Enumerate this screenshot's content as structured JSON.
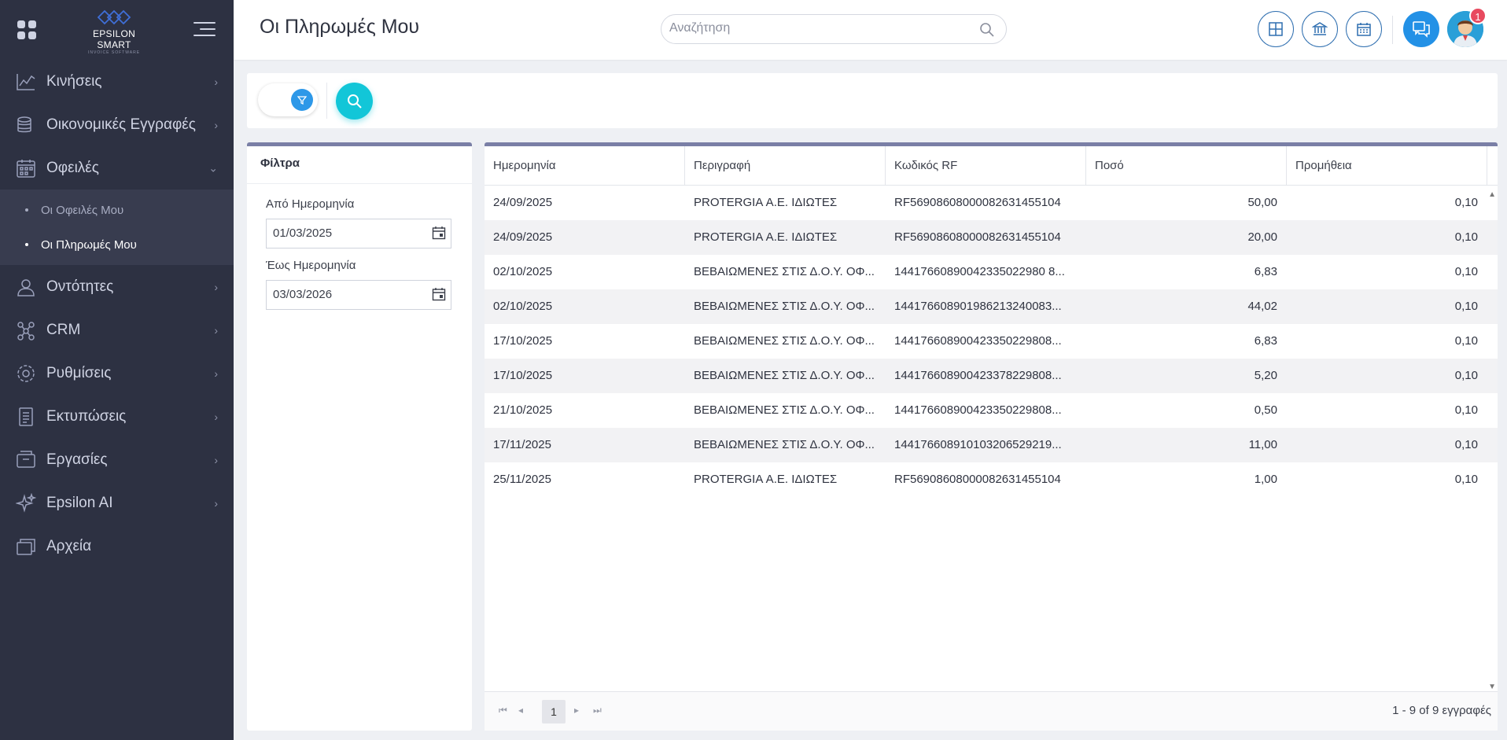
{
  "brand": {
    "name": "EPSILON SMART",
    "sub": "INVOICE SOFTWARE"
  },
  "header": {
    "title": "Οι Πληρωμές Μου",
    "search_placeholder": "Αναζήτηση",
    "notification_count": "1"
  },
  "sidebar": {
    "items": [
      {
        "label": "Κινήσεις",
        "icon": "chart-line-icon"
      },
      {
        "label": "Οικονομικές Εγγραφές",
        "icon": "coins-icon"
      },
      {
        "label": "Οφειλές",
        "icon": "calendar-grid-icon",
        "expanded": true
      },
      {
        "label": "Οντότητες",
        "icon": "user-icon"
      },
      {
        "label": "CRM",
        "icon": "network-icon"
      },
      {
        "label": "Ρυθμίσεις",
        "icon": "gear-icon"
      },
      {
        "label": "Εκτυπώσεις",
        "icon": "document-icon"
      },
      {
        "label": "Εργασίες",
        "icon": "archive-box-icon"
      },
      {
        "label": "Epsilon AI",
        "icon": "sparkle-icon"
      },
      {
        "label": "Αρχεία",
        "icon": "files-icon"
      }
    ],
    "sub_items": [
      {
        "label": "Οι Οφειλές Μου",
        "active": false
      },
      {
        "label": "Οι Πληρωμές Μου",
        "active": true
      }
    ]
  },
  "filters": {
    "title": "Φίλτρα",
    "from_label": "Από Ημερομηνία",
    "from_value": "01/03/2025",
    "to_label": "Έως Ημερομηνία",
    "to_value": "03/03/2026"
  },
  "grid": {
    "columns": [
      "Ημερομηνία",
      "Περιγραφή",
      "Κωδικός RF",
      "Ποσό",
      "Προμήθεια"
    ],
    "rows": [
      [
        "24/09/2025",
        "PROTERGIA Α.Ε. ΙΔΙΩΤΕΣ",
        "RF56908608000082631455104",
        "50,00",
        "0,10"
      ],
      [
        "24/09/2025",
        "PROTERGIA Α.Ε. ΙΔΙΩΤΕΣ",
        "RF56908608000082631455104",
        "20,00",
        "0,10"
      ],
      [
        "02/10/2025",
        "ΒΕΒΑΙΩΜΕΝΕΣ ΣΤΙΣ Δ.Ο.Υ. ΟΦ...",
        "14417660890042335022980 8...",
        "6,83",
        "0,10"
      ],
      [
        "02/10/2025",
        "ΒΕΒΑΙΩΜΕΝΕΣ ΣΤΙΣ Δ.Ο.Υ. ΟΦ...",
        "144176608901986213240083...",
        "44,02",
        "0,10"
      ],
      [
        "17/10/2025",
        "ΒΕΒΑΙΩΜΕΝΕΣ ΣΤΙΣ Δ.Ο.Υ. ΟΦ...",
        "144176608900423350229808...",
        "6,83",
        "0,10"
      ],
      [
        "17/10/2025",
        "ΒΕΒΑΙΩΜΕΝΕΣ ΣΤΙΣ Δ.Ο.Υ. ΟΦ...",
        "144176608900423378229808...",
        "5,20",
        "0,10"
      ],
      [
        "21/10/2025",
        "ΒΕΒΑΙΩΜΕΝΕΣ ΣΤΙΣ Δ.Ο.Υ. ΟΦ...",
        "144176608900423350229808...",
        "0,50",
        "0,10"
      ],
      [
        "17/11/2025",
        "ΒΕΒΑΙΩΜΕΝΕΣ ΣΤΙΣ Δ.Ο.Υ. ΟΦ...",
        "144176608910103206529219...",
        "11,00",
        "0,10"
      ],
      [
        "25/11/2025",
        "PROTERGIA Α.Ε. ΙΔΙΩΤΕΣ",
        "RF56908608000082631455104",
        "1,00",
        "0,10"
      ]
    ],
    "page": "1",
    "page_info": "1 - 9 of 9 εγγραφές"
  },
  "colors": {
    "sidebar_bg": "#2d3142",
    "accent_blue": "#2391e6",
    "search_btn": "#12c6d8",
    "panel_border": "#7a7fa6"
  }
}
